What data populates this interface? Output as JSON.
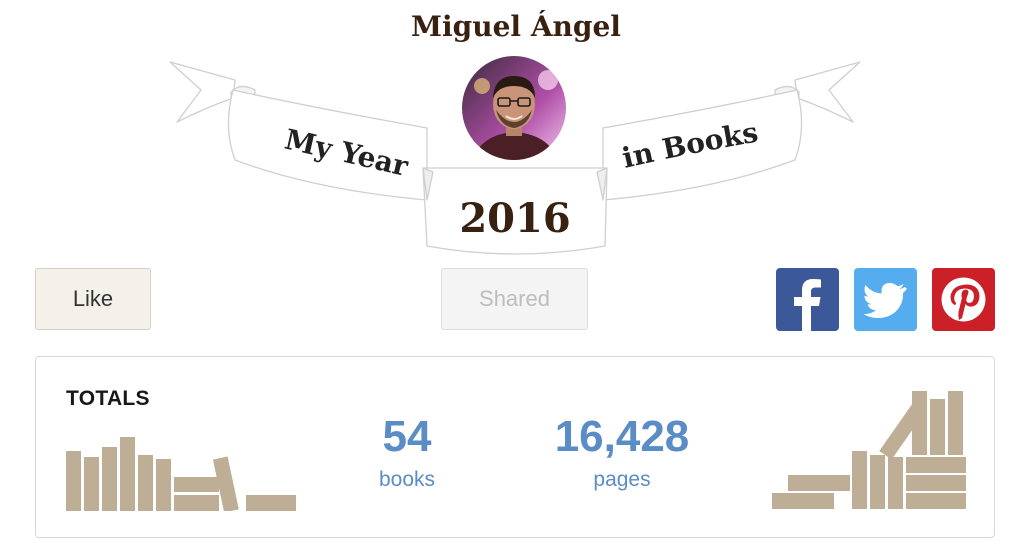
{
  "user": {
    "name": "Miguel Ángel"
  },
  "banner": {
    "left_text": "My Year",
    "right_text": "in Books",
    "year": "2016"
  },
  "actions": {
    "like_label": "Like",
    "shared_label": "Shared"
  },
  "social": [
    {
      "network": "facebook",
      "icon": "facebook-icon",
      "color": "#3b5998"
    },
    {
      "network": "twitter",
      "icon": "twitter-icon",
      "color": "#55acee"
    },
    {
      "network": "pinterest",
      "icon": "pinterest-icon",
      "color": "#cb2027"
    }
  ],
  "totals": {
    "heading": "TOTALS",
    "books": {
      "value": "54",
      "label": "books"
    },
    "pages": {
      "value": "16,428",
      "label": "pages"
    }
  },
  "colors": {
    "accent": "#5a8cc6",
    "brown_text": "#382110",
    "book_shelf": "#bfae96"
  }
}
